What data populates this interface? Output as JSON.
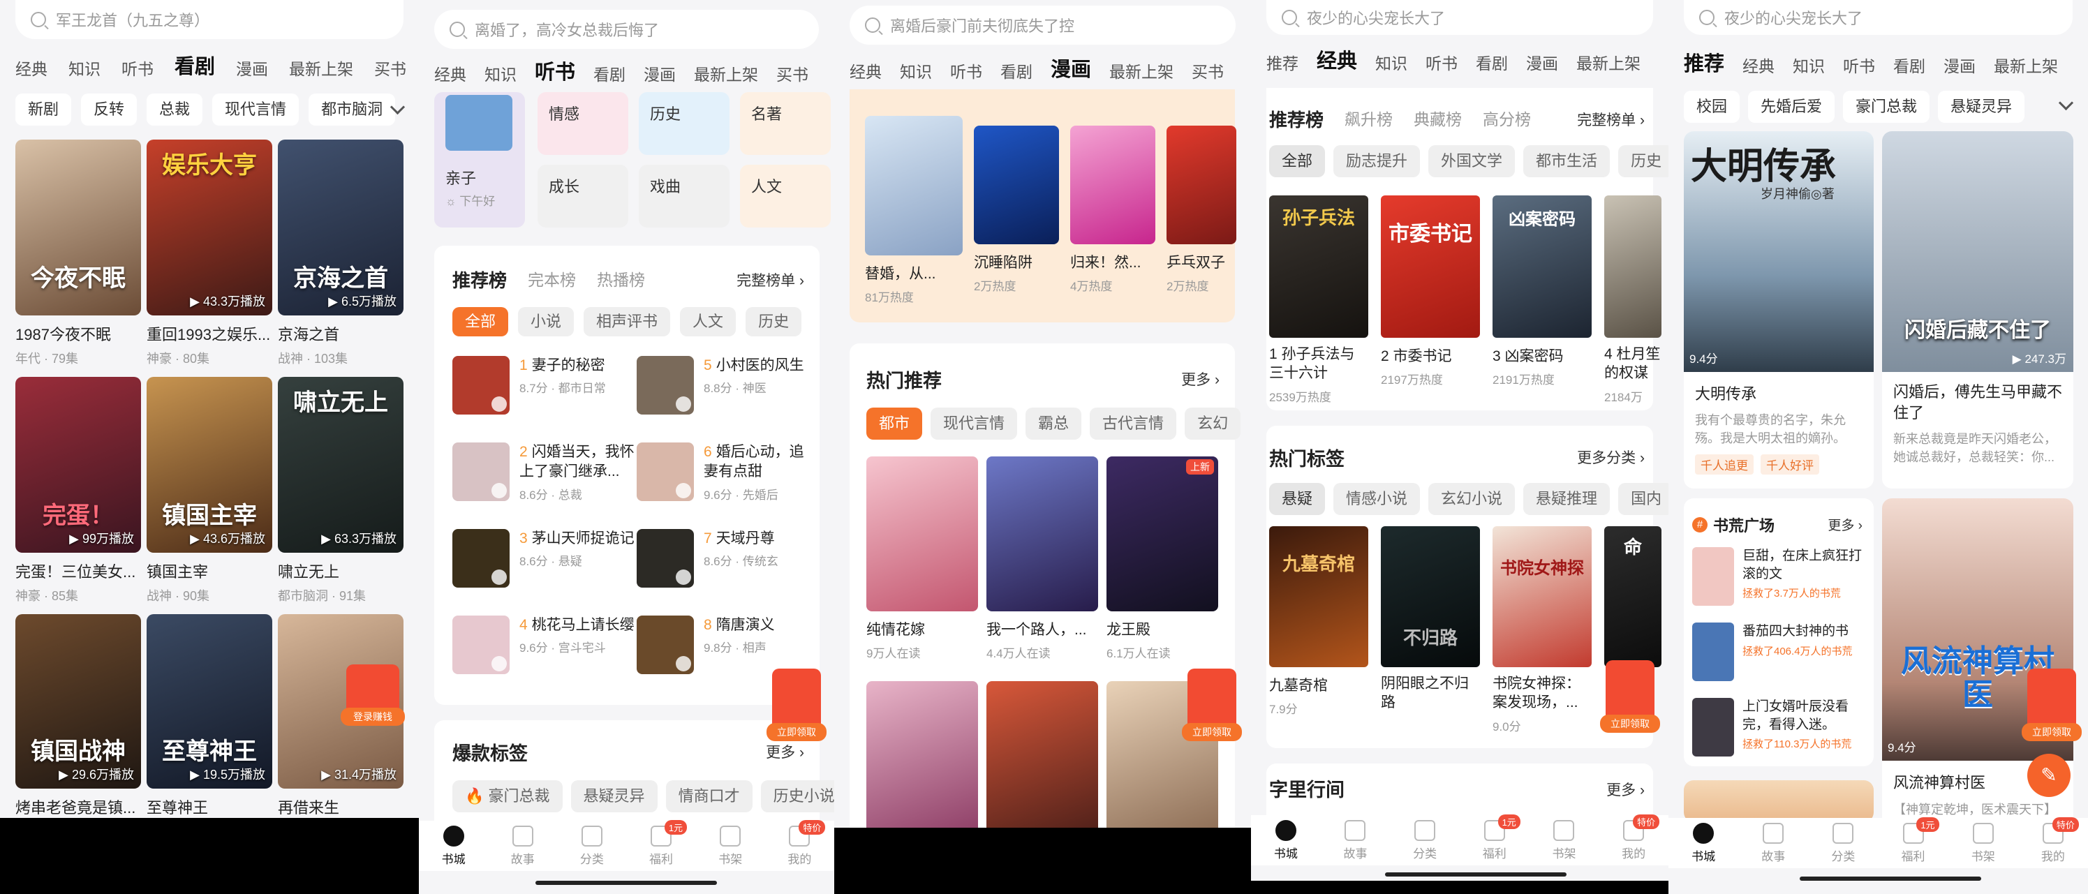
{
  "colors": {
    "accent": "#f5732a",
    "rank_num": "#f59a3a",
    "badge": "#f04e3a"
  },
  "nav": [
    "书城",
    "故事",
    "分类",
    "福利",
    "书架",
    "我的"
  ],
  "nav_badges": {
    "welfare": "1元",
    "mine": "特价"
  },
  "s1": {
    "search": "军王龙首（九五之尊）",
    "tabs": [
      "经典",
      "知识",
      "听书",
      "看剧",
      "漫画",
      "最新上架",
      "买书"
    ],
    "active": "看剧",
    "chips": [
      "新剧",
      "反转",
      "总裁",
      "现代言情",
      "都市脑洞"
    ],
    "items": [
      {
        "title": "1987今夜不眠",
        "meta": "年代 · 79集",
        "cover_text": "今夜不眠",
        "badge": ""
      },
      {
        "title": "重回1993之娱乐...",
        "meta": "神豪 · 80集",
        "cover_text": "娱乐大亨",
        "badge": "▶ 43.3万播放"
      },
      {
        "title": "京海之首",
        "meta": "战神 · 103集",
        "cover_text": "京海之首",
        "badge": "▶ 6.5万播放"
      },
      {
        "title": "完蛋！三位美女...",
        "meta": "神豪 · 85集",
        "cover_text": "完蛋！",
        "badge": "▶ 99万播放"
      },
      {
        "title": "镇国主宰",
        "meta": "战神 · 90集",
        "cover_text": "镇国主宰",
        "badge": "▶ 43.6万播放"
      },
      {
        "title": "啸立无上",
        "meta": "都市脑洞 · 91集",
        "cover_text": "啸立无上",
        "badge": "▶ 63.3万播放"
      },
      {
        "title": "烤串老爸竟是镇...",
        "meta": "",
        "cover_text": "镇国战神",
        "badge": "▶ 29.6万播放"
      },
      {
        "title": "至尊神王",
        "meta": "",
        "cover_text": "至尊神王",
        "badge": "▶ 19.5万播放"
      },
      {
        "title": "再借来生",
        "meta": "",
        "cover_text": "",
        "badge": "▶ 31.4万播放"
      }
    ],
    "gift": "登录赚钱"
  },
  "s2": {
    "search": "离婚了，高冷女总裁后悔了",
    "tabs": [
      "经典",
      "知识",
      "听书",
      "看剧",
      "漫画",
      "最新上架",
      "买书"
    ],
    "active": "听书",
    "cats": [
      {
        "name": "亲子",
        "sub": "☼ 下午好"
      },
      {
        "name": "情感"
      },
      {
        "name": "历史"
      },
      {
        "name": "名著"
      },
      {
        "name": "成长"
      },
      {
        "name": "戏曲"
      },
      {
        "name": "人文"
      }
    ],
    "rank_tabs": [
      "推荐榜",
      "完本榜",
      "热播榜"
    ],
    "full_list": "完整榜单 ›",
    "filters": [
      "全部",
      "小说",
      "相声评书",
      "人文",
      "历史"
    ],
    "ranks": [
      {
        "no": "1",
        "name": "妻子的秘密",
        "sub": "8.7分 · 都市日常"
      },
      {
        "no": "2",
        "name": "闪婚当天，我怀上了豪门继承...",
        "sub": "8.6分 · 总裁"
      },
      {
        "no": "3",
        "name": "茅山天师捉诡记",
        "sub": "8.6分 · 悬疑"
      },
      {
        "no": "4",
        "name": "桃花马上请长缨",
        "sub": "9.6分 · 宫斗宅斗"
      },
      {
        "no": "5",
        "name": "小村医的风生",
        "sub": "8.8分 · 神医"
      },
      {
        "no": "6",
        "name": "婚后心动，追妻有点甜",
        "sub": "9.6分 · 先婚后"
      },
      {
        "no": "7",
        "name": "天域丹尊",
        "sub": "8.6分 · 传统玄"
      },
      {
        "no": "8",
        "name": "隋唐演义",
        "sub": "9.8分 · 相声"
      }
    ],
    "hot_title": "爆款标签",
    "more": "更多 ›",
    "hot_tags": [
      "豪门总裁",
      "悬疑灵异",
      "情商口才",
      "历史小说"
    ],
    "gift": "立即领取"
  },
  "s3": {
    "search": "离婚后豪门前夫彻底失了控",
    "tabs": [
      "经典",
      "知识",
      "听书",
      "看剧",
      "漫画",
      "最新上架",
      "买书"
    ],
    "active": "漫画",
    "top_items": [
      {
        "t": "替婚，从...",
        "s": "81万热度"
      },
      {
        "t": "沉睡陷阱",
        "s": "2万热度"
      },
      {
        "t": "归来！然...",
        "s": "4万热度"
      },
      {
        "t": "乒乓双子",
        "s": "2万热度"
      }
    ],
    "hot_title": "热门推荐",
    "more": "更多 ›",
    "filters": [
      "都市",
      "现代言情",
      "霸总",
      "古代言情",
      "玄幻"
    ],
    "items": [
      {
        "t": "纯情花嫁",
        "s": "9万人在读"
      },
      {
        "t": "我一个路人，...",
        "s": "4.4万人在读"
      },
      {
        "t": "龙王殿",
        "s": "6.1万人在读"
      }
    ],
    "badge_new": "上新",
    "gift": "立即领取"
  },
  "s4": {
    "search": "夜少的心尖宠长大了",
    "tabs": [
      "推荐",
      "经典",
      "知识",
      "听书",
      "看剧",
      "漫画",
      "最新上架"
    ],
    "active": "经典",
    "rank_tabs": [
      "推荐榜",
      "飙升榜",
      "典藏榜",
      "高分榜"
    ],
    "full_list": "完整榜单 ›",
    "filters": [
      "全部",
      "励志提升",
      "外国文学",
      "都市生活",
      "历史"
    ],
    "books": [
      {
        "t": "1 孙子兵法与三十六计",
        "s": "2539万热度",
        "cover": "孙子兵法"
      },
      {
        "t": "2 市委书记",
        "s": "2197万热度",
        "cover": "市委书记"
      },
      {
        "t": "3 凶案密码",
        "s": "2191万热度",
        "cover": "凶案密码"
      },
      {
        "t": "4 杜月笙的权谋",
        "s": "2184万",
        "cover": ""
      }
    ],
    "tags_title": "热门标签",
    "tags_more": "更多分类 ›",
    "tag_filters": [
      "悬疑",
      "情感小说",
      "玄幻小说",
      "悬疑推理",
      "国内"
    ],
    "tag_books": [
      {
        "t": "九墓奇棺",
        "s": "7.9分",
        "cover": "九墓奇棺"
      },
      {
        "t": "阴阳眼之不归路",
        "s": "",
        "cover": "不归路"
      },
      {
        "t": "书院女神探：案发现场，...",
        "s": "9.0分",
        "cover": "书院女神探"
      },
      {
        "t": "命",
        "s": "",
        "cover": "命"
      }
    ],
    "bottom_title": "字里行间",
    "more": "更多 ›",
    "gift": "立即领取"
  },
  "s5": {
    "search": "夜少的心尖宠长大了",
    "tabs": [
      "推荐",
      "经典",
      "知识",
      "听书",
      "看剧",
      "漫画",
      "最新上架"
    ],
    "active": "推荐",
    "chips": [
      "校园",
      "先婚后爱",
      "豪门总裁",
      "悬疑灵异"
    ],
    "left_book": {
      "title": "大明传承",
      "desc": "我有个最尊贵的名字，朱允殇。我是大明太祖的嫡孙。",
      "tags": [
        "千人追更",
        "千人好评"
      ],
      "score": "9.4分",
      "cover": "大明传承",
      "author": "岁月神偷◎著"
    },
    "right_book": {
      "title": "闪婚后，傅先生马甲藏不住了",
      "desc": "新来总裁竟是昨天闪婚老公，她诚总裁好，总裁轻笑：你...",
      "plays": "▶ 247.3万",
      "cover": "闪婚后藏不住了"
    },
    "square_title": "书荒广场",
    "square_more": "更多 ›",
    "square": [
      {
        "t": "巨甜，在床上疯狂打滚的文",
        "s": "拯救了3.7万人的书荒"
      },
      {
        "t": "番茄四大封神的书",
        "s": "拯救了406.4万人的书荒"
      },
      {
        "t": "上门女婿叶辰没看完，看得入迷。",
        "s": "拯救了110.3万人的书荒"
      }
    ],
    "third": {
      "title": "风流神算村医",
      "desc": "【神算定乾坤，医术震天下】",
      "score": "9.4分",
      "cover": "风流神算村医"
    },
    "gift": "立即领取"
  }
}
